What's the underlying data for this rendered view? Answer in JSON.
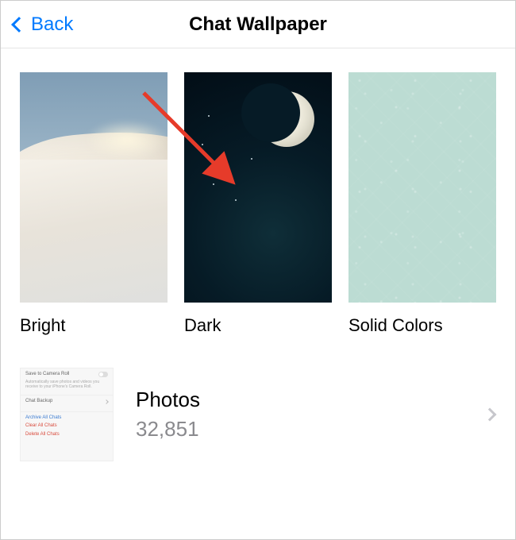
{
  "nav": {
    "back_label": "Back",
    "title": "Chat Wallpaper"
  },
  "thumbs": [
    {
      "label": "Bright"
    },
    {
      "label": "Dark"
    },
    {
      "label": "Solid Colors"
    }
  ],
  "photos": {
    "title": "Photos",
    "count": "32,851",
    "preview": {
      "row1_label": "Save to Camera Roll",
      "row1_sub": "Automatically save photos and videos you receive to your iPhone's Camera Roll.",
      "row2_label": "Chat Backup",
      "link1": "Archive All Chats",
      "link2": "Clear All Chats",
      "link3": "Delete All Chats"
    }
  },
  "annotation": {
    "arrow_target": "Dark"
  }
}
